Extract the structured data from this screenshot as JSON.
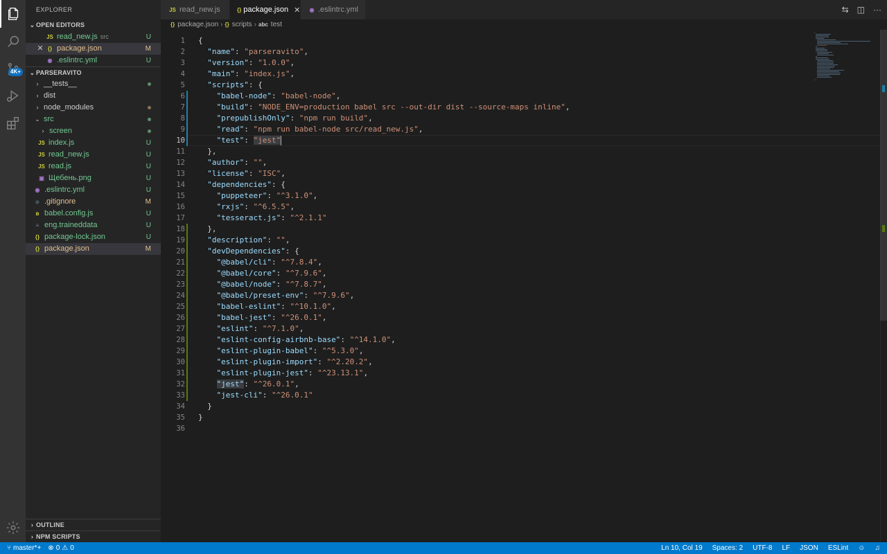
{
  "activity": {
    "scm_badge": "4K+"
  },
  "sidebar": {
    "title": "EXPLORER",
    "open_editors_label": "OPEN EDITORS",
    "open_editors": [
      {
        "name": "read_new.js",
        "desc": "src",
        "status": "U",
        "icon": "JS"
      },
      {
        "name": "package.json",
        "desc": "",
        "status": "M",
        "icon": "{}"
      },
      {
        "name": ".eslintrc.yml",
        "desc": "",
        "status": "U",
        "icon": "yml"
      }
    ],
    "project_label": "PARSERAVITO",
    "tree": [
      {
        "name": "__tests__",
        "status": ""
      },
      {
        "name": "dist",
        "status": ""
      },
      {
        "name": "node_modules",
        "status": ""
      },
      {
        "name": "src",
        "status": ""
      },
      {
        "name": "screen",
        "status": ""
      },
      {
        "name": "index.js",
        "status": "U"
      },
      {
        "name": "read_new.js",
        "status": "U"
      },
      {
        "name": "read.js",
        "status": "U"
      },
      {
        "name": "Щебень.png",
        "status": "U"
      },
      {
        "name": ".eslintrc.yml",
        "status": "U"
      },
      {
        "name": ".gitignore",
        "status": "M"
      },
      {
        "name": "babel.config.js",
        "status": "U"
      },
      {
        "name": "eng.traineddata",
        "status": "U"
      },
      {
        "name": "package-lock.json",
        "status": "U"
      },
      {
        "name": "package.json",
        "status": "M"
      }
    ],
    "outline_label": "OUTLINE",
    "npm_label": "NPM SCRIPTS"
  },
  "tabs": [
    {
      "label": "read_new.js",
      "icon": "JS"
    },
    {
      "label": "package.json",
      "icon": "{}"
    },
    {
      "label": ".eslintrc.yml",
      "icon": "yml"
    }
  ],
  "breadcrumb": {
    "file": "package.json",
    "part1": "scripts",
    "part2": "test"
  },
  "code_lines": [
    "{",
    "  \"name\": \"parseravito\",",
    "  \"version\": \"1.0.0\",",
    "  \"main\": \"index.js\",",
    "  \"scripts\": {",
    "    \"babel-node\": \"babel-node\",",
    "    \"build\": \"NODE_ENV=production babel src --out-dir dist --source-maps inline\",",
    "    \"prepublishOnly\": \"npm run build\",",
    "    \"read\": \"npm run babel-node src/read_new.js\",",
    "    \"test\": \"jest\"",
    "  },",
    "  \"author\": \"\",",
    "  \"license\": \"ISC\",",
    "  \"dependencies\": {",
    "    \"puppeteer\": \"^3.1.0\",",
    "    \"rxjs\": \"^6.5.5\",",
    "    \"tesseract.js\": \"^2.1.1\"",
    "  },",
    "  \"description\": \"\",",
    "  \"devDependencies\": {",
    "    \"@babel/cli\": \"^7.8.4\",",
    "    \"@babel/core\": \"^7.9.6\",",
    "    \"@babel/node\": \"^7.8.7\",",
    "    \"@babel/preset-env\": \"^7.9.6\",",
    "    \"babel-eslint\": \"^10.1.0\",",
    "    \"babel-jest\": \"^26.0.1\",",
    "    \"eslint\": \"^7.1.0\",",
    "    \"eslint-config-airbnb-base\": \"^14.1.0\",",
    "    \"eslint-plugin-babel\": \"^5.3.0\",",
    "    \"eslint-plugin-import\": \"^2.20.2\",",
    "    \"eslint-plugin-jest\": \"^23.13.1\",",
    "    \"jest\": \"^26.0.1\",",
    "    \"jest-cli\": \"^26.0.1\"",
    "  }",
    "}",
    ""
  ],
  "statusbar": {
    "branch": "master*+",
    "errors": "0",
    "warnings": "0",
    "position": "Ln 10, Col 19",
    "spaces": "Spaces: 2",
    "encoding": "UTF-8",
    "eol": "LF",
    "language": "JSON",
    "linter": "ESLint"
  },
  "colors": {
    "accent": "#007acc",
    "key": "#9cdcfe",
    "string": "#ce9178",
    "untracked": "#73c991",
    "modified": "#e2c08d"
  }
}
